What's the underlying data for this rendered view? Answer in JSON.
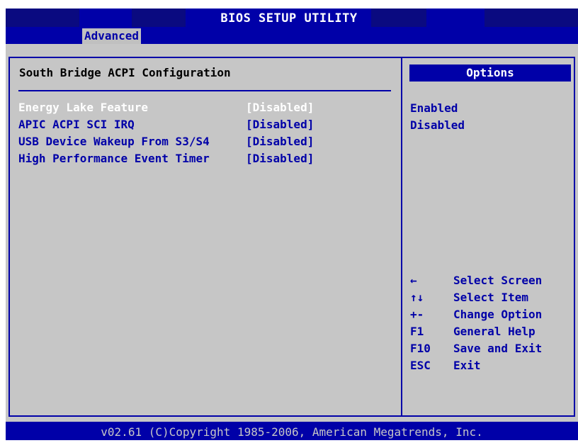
{
  "app": {
    "title": "BIOS SETUP UTILITY"
  },
  "tabs": [
    {
      "label": "Advanced",
      "active": true
    }
  ],
  "main": {
    "section_title": "South Bridge ACPI Configuration",
    "settings": [
      {
        "label": "Energy Lake Feature",
        "value": "[Disabled]",
        "selected": true
      },
      {
        "label": "APIC ACPI SCI IRQ",
        "value": "[Disabled]",
        "selected": false
      },
      {
        "label": "USB Device Wakeup From S3/S4",
        "value": "[Disabled]",
        "selected": false
      },
      {
        "label": "High Performance Event Timer",
        "value": "[Disabled]",
        "selected": false
      }
    ]
  },
  "options": {
    "header": "Options",
    "items": [
      "Enabled",
      "Disabled"
    ]
  },
  "help": [
    {
      "key": "←",
      "desc": "Select Screen"
    },
    {
      "key": "↑↓",
      "desc": "Select Item"
    },
    {
      "key": "+-",
      "desc": "Change Option"
    },
    {
      "key": "F1",
      "desc": "General Help"
    },
    {
      "key": "F10",
      "desc": "Save and Exit"
    },
    {
      "key": "ESC",
      "desc": "Exit"
    }
  ],
  "footer": {
    "text": "v02.61 (C)Copyright 1985-2006, American Megatrends, Inc."
  },
  "colors": {
    "bios_blue": "#0000a8",
    "panel_gray": "#c6c6c6",
    "highlight_text": "#ffffff"
  }
}
